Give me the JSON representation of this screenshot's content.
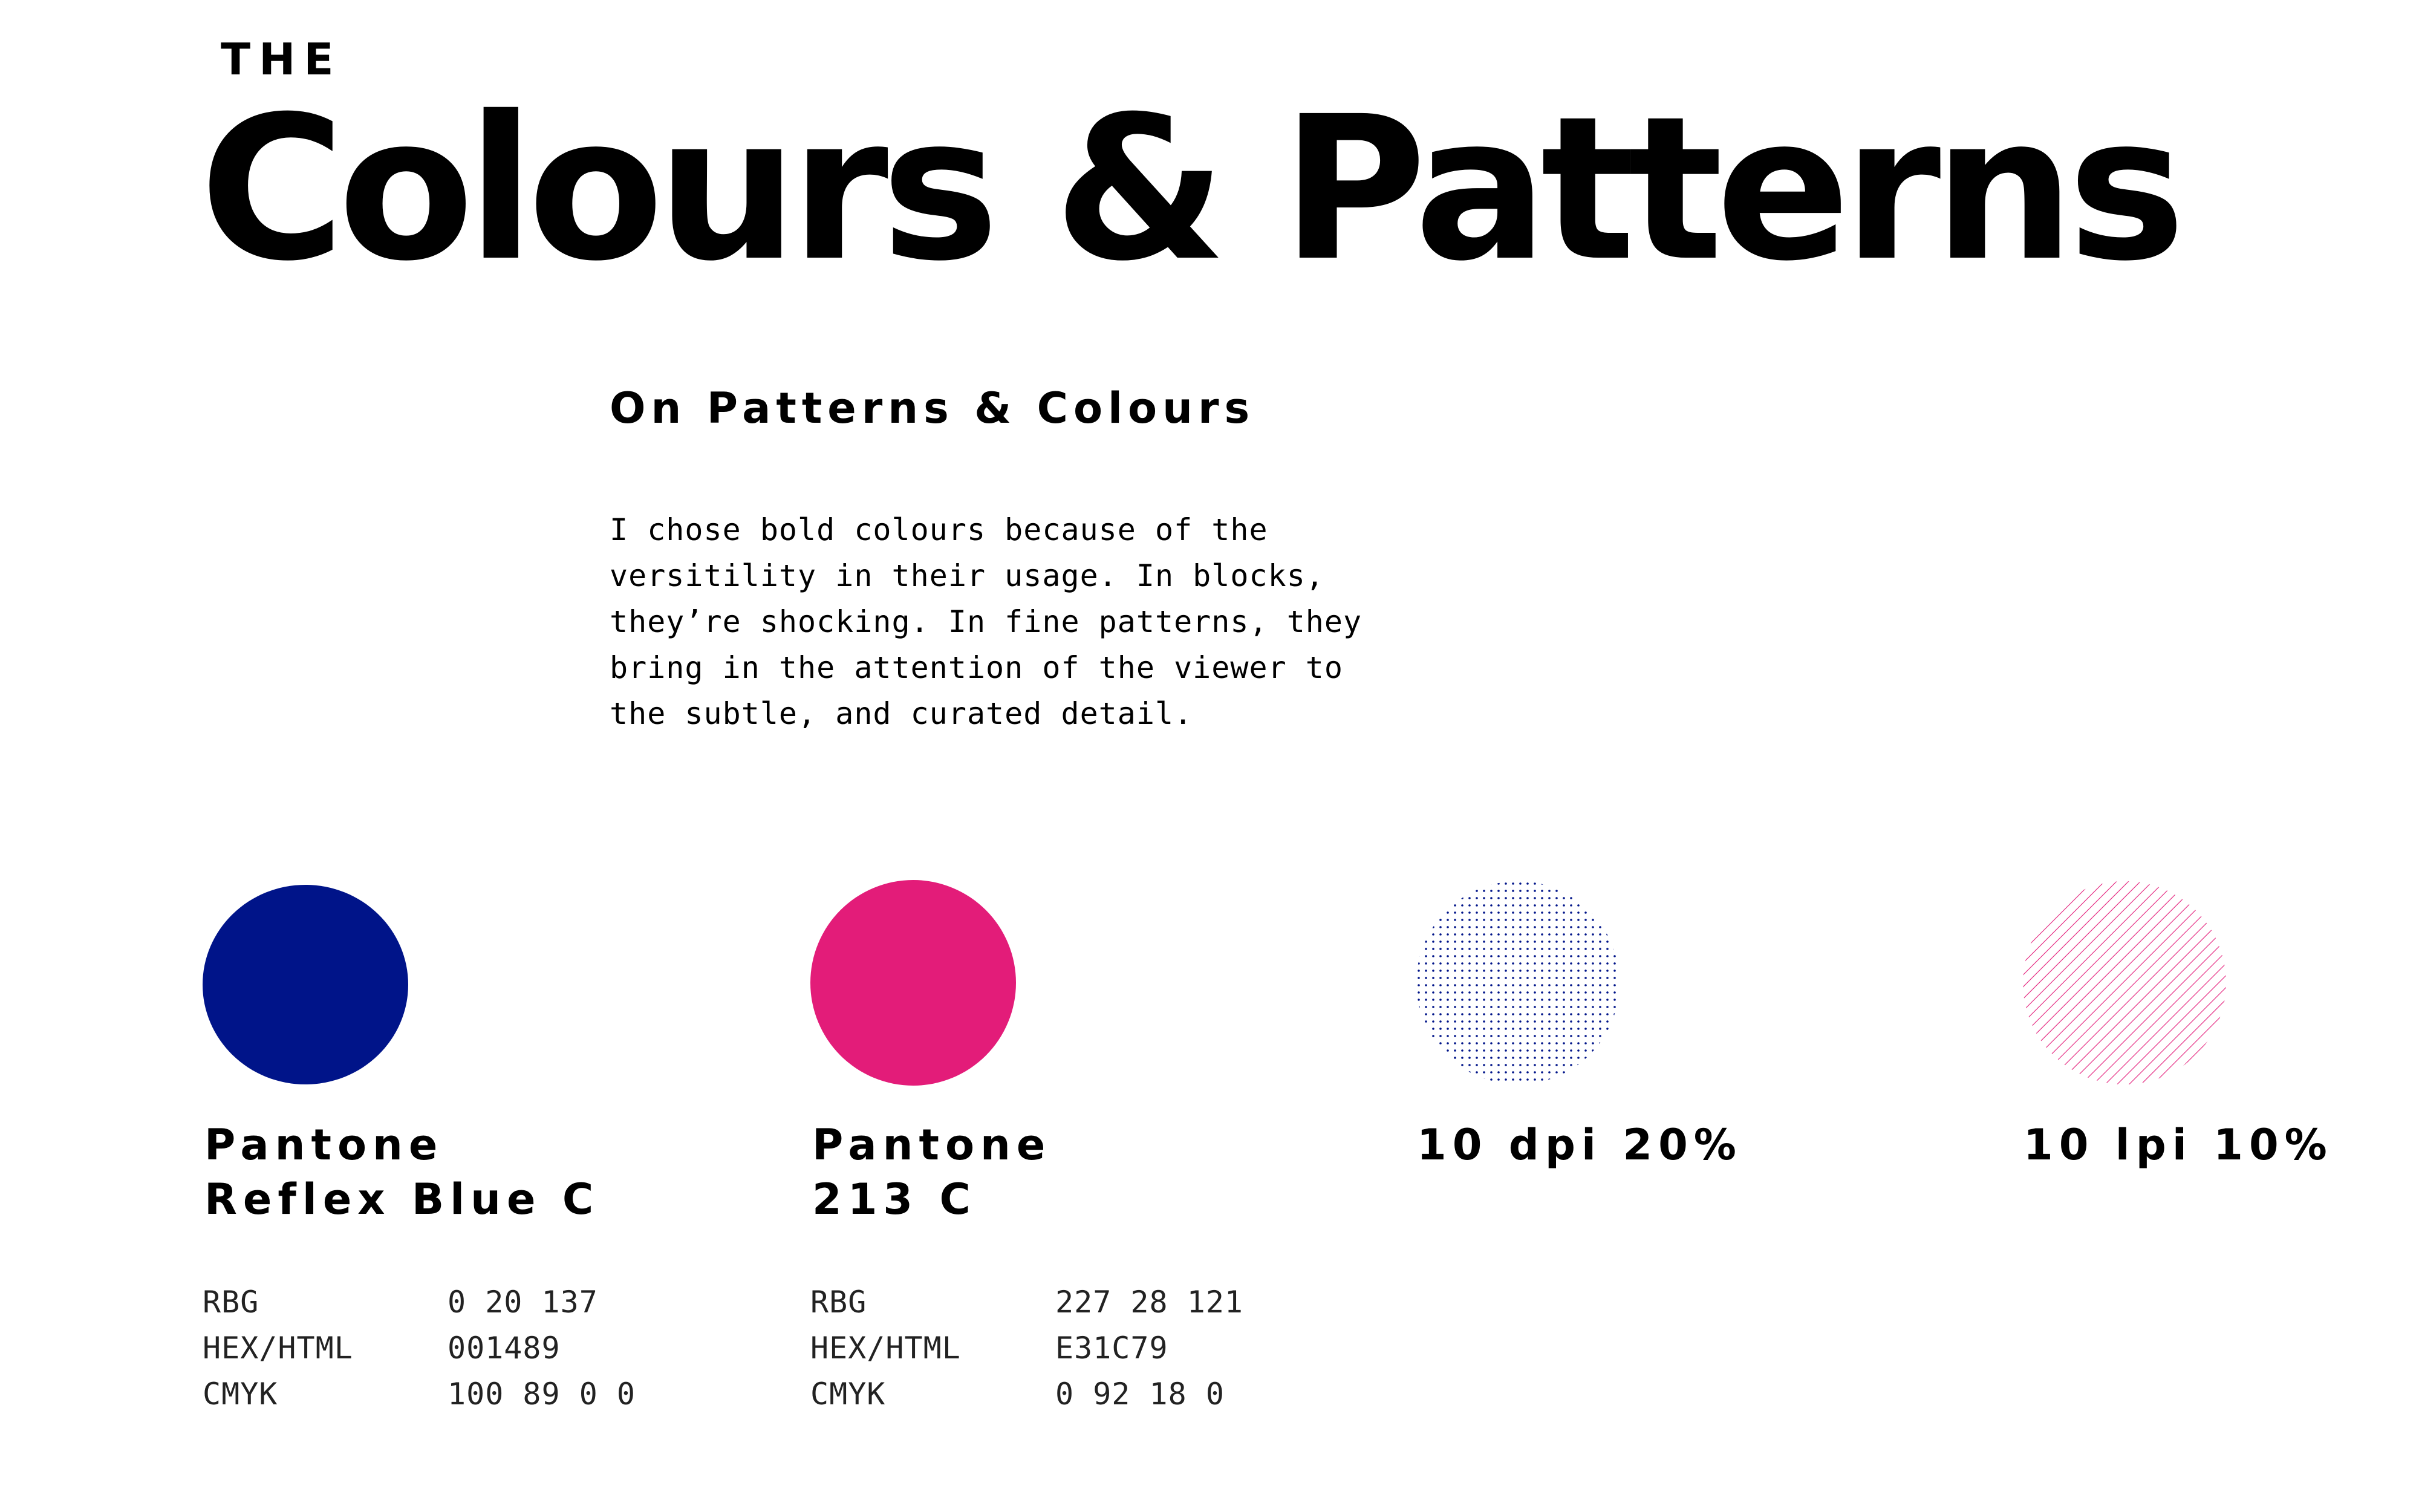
{
  "header": {
    "eyebrow": "THE",
    "title": "Colours & Patterns"
  },
  "intro": {
    "heading": "On Patterns & Colours",
    "body": "I chose bold colours because of the\nversitility in their usage.  In blocks,\nthey’re shocking.  In fine patterns, they\nbring in the attention of the viewer to\nthe subtle, and curated detail."
  },
  "swatches": [
    {
      "label": "Pantone\nReflex Blue C",
      "color": "#001489",
      "specs": [
        {
          "key": "RBG",
          "value": "0 20 137"
        },
        {
          "key": "HEX/HTML",
          "value": "001489"
        },
        {
          "key": "CMYK",
          "value": "100 89 0 0"
        }
      ]
    },
    {
      "label": "Pantone\n213 C",
      "color": "#E31C79",
      "specs": [
        {
          "key": "RBG",
          "value": "227 28 121"
        },
        {
          "key": "HEX/HTML",
          "value": "E31C79"
        },
        {
          "key": "CMYK",
          "value": "0 92 18 0"
        }
      ]
    },
    {
      "label": "10 dpi 20%",
      "pattern": "dots",
      "color": "#001489"
    },
    {
      "label": "10 lpi 10%",
      "pattern": "lines",
      "color": "#E31C79"
    }
  ]
}
